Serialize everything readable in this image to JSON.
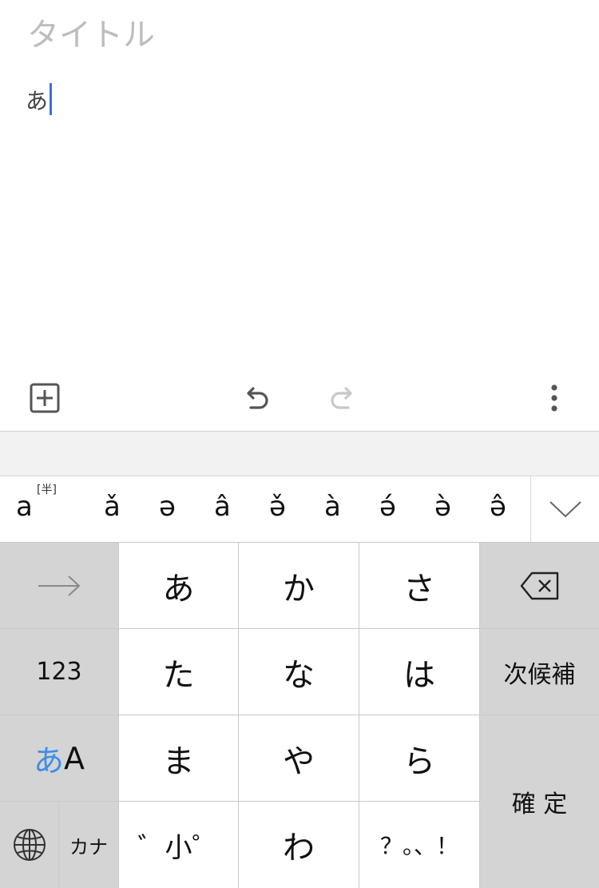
{
  "editor": {
    "title_placeholder": "タイトル",
    "body_text": "あ"
  },
  "toolbar": {
    "add_icon": "add-box-icon",
    "undo_icon": "undo-icon",
    "redo_icon": "redo-icon",
    "more_icon": "more-vertical-icon",
    "redo_enabled": false
  },
  "suggestions": {
    "items": [
      "a",
      "ǎ",
      "ə",
      "â",
      "ə̌",
      "à",
      "ə́",
      "ə̀",
      "ə̂"
    ],
    "first_note": "[半]",
    "toggle_icon": "chevron-down-icon"
  },
  "keyboard": {
    "arrow_icon": "arrow-right-icon",
    "numbers_label": "123",
    "mode_label_kana": "あ",
    "mode_label_alpha": "A",
    "globe_icon": "globe-icon",
    "kana_label": "カナ",
    "kana_keys": [
      "あ",
      "か",
      "さ",
      "た",
      "な",
      "は",
      "ま",
      "や",
      "ら",
      "゛小゜",
      "わ",
      "？。、！"
    ],
    "delete_icon": "delete-icon",
    "next_candidate_label": "次候補",
    "confirm_label": "確 定"
  },
  "colors": {
    "caret": "#3b6fe8",
    "mode_highlight": "#3d8ee6",
    "key_light": "#ffffff",
    "key_dark": "#d4d4d4"
  }
}
